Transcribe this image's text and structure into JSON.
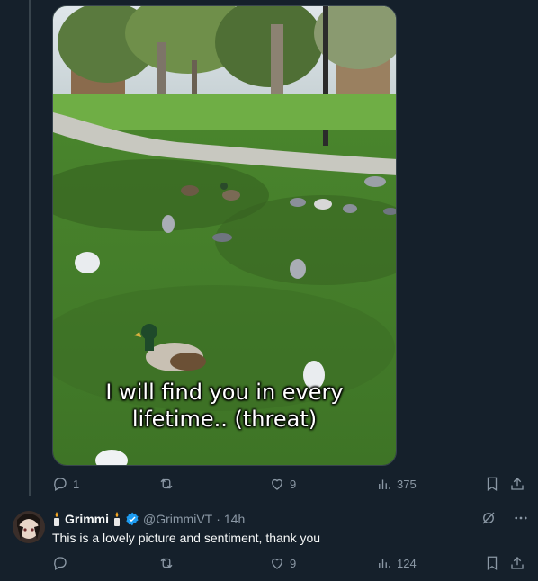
{
  "post": {
    "caption_line1": "I will find you in every",
    "caption_line2": "lifetime.. (threat)",
    "actions": {
      "replies": "1",
      "reposts": "",
      "likes": "9",
      "views": "375"
    }
  },
  "reply": {
    "name": "Grimmi",
    "handle": "@GrimmiVT",
    "separator": "·",
    "time": "14h",
    "text": "This is a lovely picture and sentiment, thank you",
    "actions": {
      "replies": "",
      "reposts": "",
      "likes": "9",
      "views": "124"
    }
  },
  "icons": [
    "reply-icon",
    "repost-icon",
    "like-icon",
    "views-icon",
    "bookmark-icon",
    "share-icon",
    "verified-icon",
    "grok-icon",
    "more-icon",
    "candle-icon"
  ],
  "colors": {
    "background": "#15202b",
    "muted": "#8b98a5",
    "verified": "#1d9bf0",
    "text": "#f7f9f9"
  }
}
